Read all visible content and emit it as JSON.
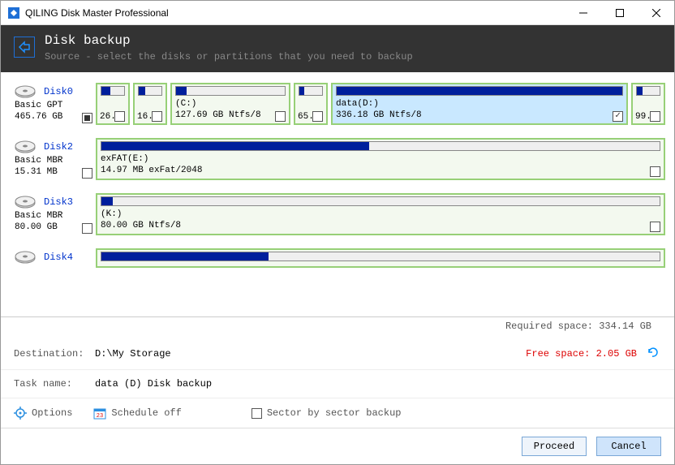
{
  "window": {
    "title": "QILING Disk Master Professional"
  },
  "header": {
    "title": "Disk backup",
    "subtitle": "Source - select the disks or partitions that you need to backup"
  },
  "disks": {
    "d0": {
      "name": "Disk0",
      "type": "Basic GPT",
      "size": "465.76 GB"
    },
    "d0_p0": {
      "nsize": "26."
    },
    "d0_p1": {
      "nsize": "16."
    },
    "d0_p2": {
      "label": "(C:)",
      "detail": "127.69 GB Ntfs/8"
    },
    "d0_p3": {
      "nsize": "65."
    },
    "d0_p4": {
      "label": "data(D:)",
      "detail": "336.18 GB Ntfs/8"
    },
    "d0_p5": {
      "nsize": "99."
    },
    "d2": {
      "name": "Disk2",
      "type": "Basic MBR",
      "size": "15.31 MB"
    },
    "d2_p0": {
      "label": "exFAT(E:)",
      "detail": "14.97 MB exFat/2048"
    },
    "d3": {
      "name": "Disk3",
      "type": "Basic MBR",
      "size": "80.00 GB"
    },
    "d3_p0": {
      "label": "(K:)",
      "detail": "80.00 GB Ntfs/8"
    },
    "d4": {
      "name": "Disk4"
    }
  },
  "required_space": "Required space: 334.14 GB",
  "destination": {
    "label": "Destination:",
    "value": "D:\\My Storage",
    "free": "Free space: 2.05 GB"
  },
  "taskname": {
    "label": "Task name:",
    "value": "data (D) Disk backup"
  },
  "options": {
    "options_label": "Options",
    "schedule_label": "Schedule off",
    "sector_label": "Sector by sector backup"
  },
  "footer": {
    "proceed": "Proceed",
    "cancel": "Cancel"
  }
}
